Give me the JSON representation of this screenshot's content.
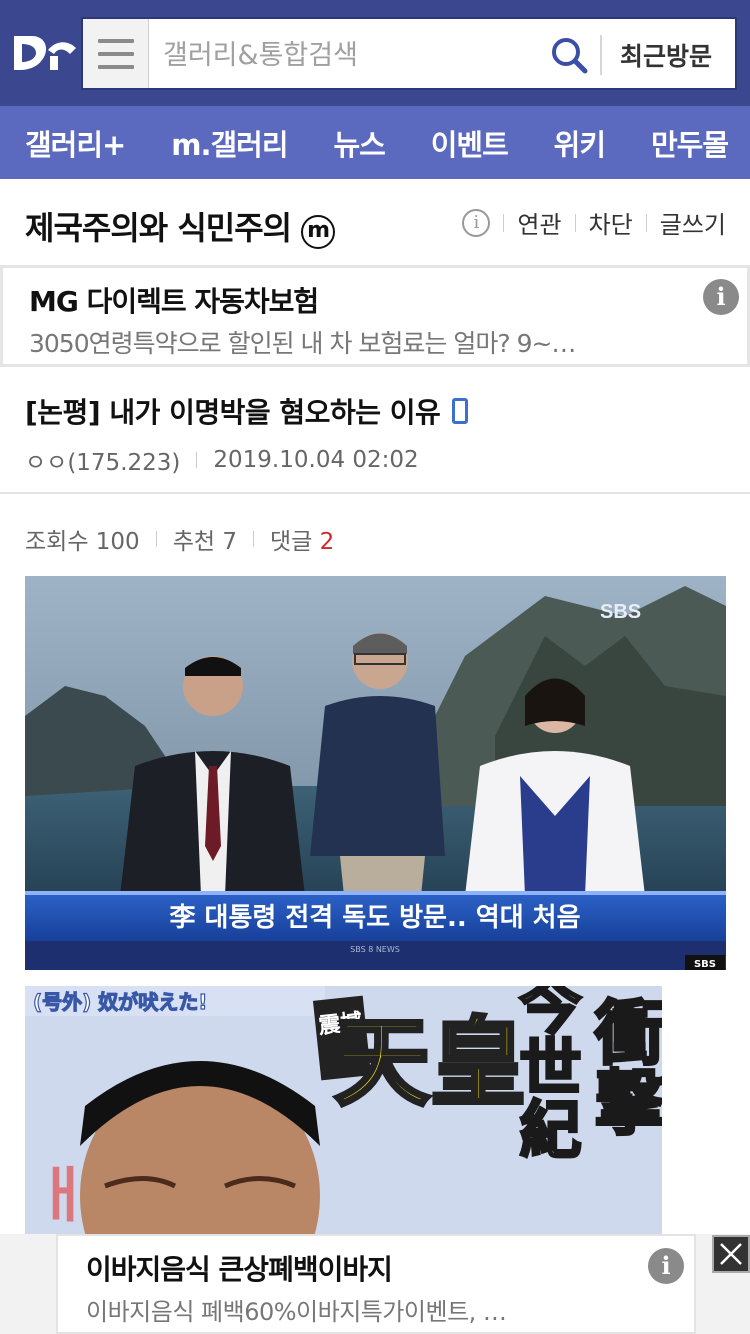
{
  "header": {
    "logo_icon": "dc-logo-icon",
    "menu_icon": "hamburger-menu-icon",
    "search_placeholder": "갤러리&통합검색",
    "search_icon": "search-icon",
    "recent_label": "최근방문",
    "brand_color": "#3b4890"
  },
  "nav": {
    "items": [
      {
        "label": "갤러리+"
      },
      {
        "label": "m.갤러리"
      },
      {
        "label": "뉴스"
      },
      {
        "label": "이벤트"
      },
      {
        "label": "위키"
      },
      {
        "label": "만두몰"
      }
    ],
    "color": "#5b69bf"
  },
  "gallery": {
    "title": "제국주의와 식민주의",
    "badge": "ⓜ",
    "info_icon": "info-icon",
    "tools": {
      "related": "연관",
      "block": "차단",
      "write": "글쓰기"
    }
  },
  "ad_top": {
    "title": "MG 다이렉트 자동차보험",
    "desc": "3050연령특약으로 할인된 내 차 보험료는 얼마? 9~…",
    "info_icon": "info-icon"
  },
  "post": {
    "title": "[논평] 내가 이명박을 혐오하는 이유",
    "mobile_icon": "mobile-phone-icon",
    "author": "ㅇㅇ(175.223)",
    "date": "2019.10.04 02:02",
    "views_label": "조회수 100",
    "recommend_label": "추천 7",
    "comments_label": "댓글",
    "comments_count": "2"
  },
  "images": {
    "news_caption": "李 대통령 전격 독도 방문.. 역대 처음",
    "news_logo": "SBS",
    "news_strip": "SBS 8 NEWS",
    "magazine_headline": "(号外) 奴が吠えた!",
    "magazine_big": "天皇",
    "magazine_right1": "衝撃",
    "magazine_right2": "今世紀",
    "magazine_side": "震撼"
  },
  "ad_bottom": {
    "title": "이바지음식 큰상폐백이바지",
    "desc": "이바지음식 폐백60%이바지특가이벤트, …",
    "info_icon": "info-icon",
    "close_icon": "close-icon"
  }
}
